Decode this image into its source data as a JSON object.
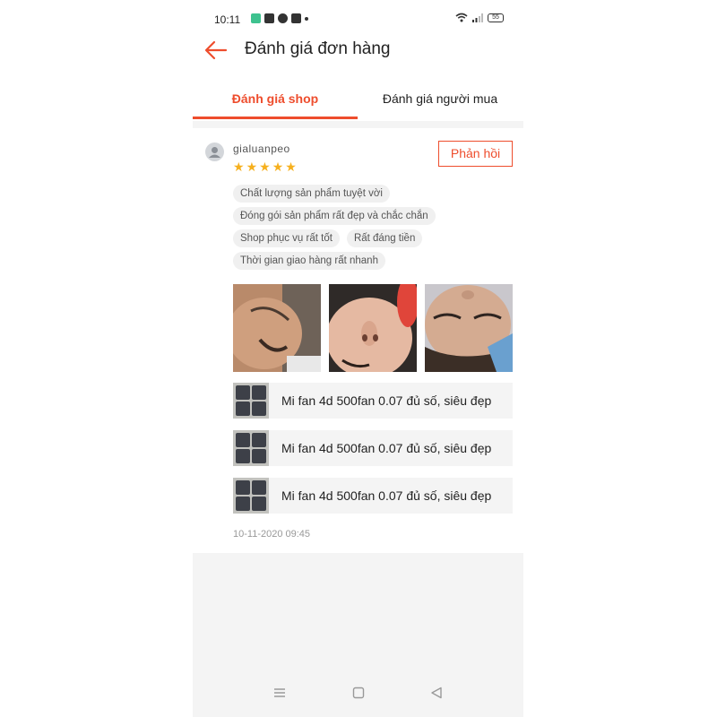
{
  "status_bar": {
    "time": "10:11",
    "battery": "55"
  },
  "header": {
    "title": "Đánh giá đơn hàng",
    "back_icon": "arrow-left-icon"
  },
  "tabs": [
    {
      "label": "Đánh giá shop",
      "active": true
    },
    {
      "label": "Đánh giá người mua",
      "active": false
    }
  ],
  "review": {
    "username": "gialuanpeo",
    "rating": 5,
    "reply_label": "Phản hồi",
    "tags": [
      "Chất lượng sản phẩm tuyệt vời",
      "Đóng gói sản phẩm rất đẹp và chắc chắn",
      "Shop phục vụ rất tốt",
      "Rất đáng tiền",
      "Thời gian giao hàng rất nhanh"
    ],
    "photo_count": 3,
    "products": [
      {
        "name": "Mi fan 4d 500fan 0.07 đủ số, siêu đẹp"
      },
      {
        "name": "Mi fan 4d 500fan 0.07 đủ số, siêu đẹp"
      },
      {
        "name": "Mi fan 4d 500fan 0.07 đủ số, siêu đẹp"
      }
    ],
    "timestamp": "10-11-2020 09:45"
  },
  "colors": {
    "accent": "#ee4d2d",
    "star": "#f6b01e"
  }
}
